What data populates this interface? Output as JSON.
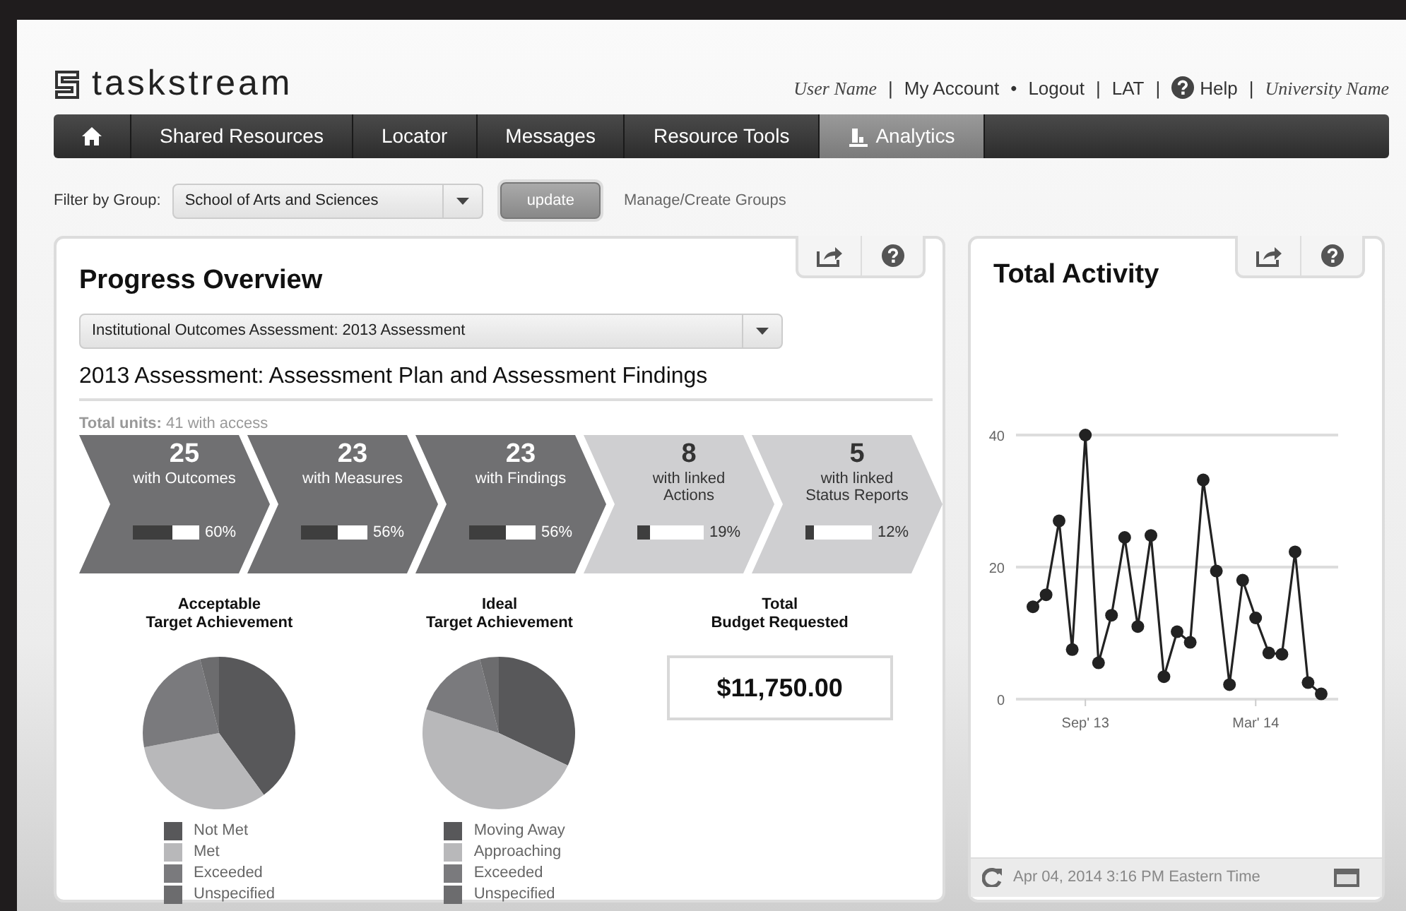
{
  "header": {
    "logo": "taskstream",
    "links": [
      {
        "kind": "name",
        "text": "User Name"
      },
      {
        "kind": "sep",
        "text": "|"
      },
      {
        "kind": "link",
        "text": "My Account"
      },
      {
        "kind": "sep",
        "text": "•"
      },
      {
        "kind": "link",
        "text": "Logout"
      },
      {
        "kind": "sep",
        "text": "|"
      },
      {
        "kind": "link",
        "text": "LAT"
      },
      {
        "kind": "sep",
        "text": "|"
      },
      {
        "kind": "help",
        "text": "Help"
      },
      {
        "kind": "sep",
        "text": "|"
      },
      {
        "kind": "name",
        "text": "University Name"
      }
    ]
  },
  "nav": {
    "items": [
      {
        "label": "Shared Resources",
        "selected": false,
        "icon": false
      },
      {
        "label": "Locator",
        "selected": false,
        "icon": false
      },
      {
        "label": "Messages",
        "selected": false,
        "icon": false
      },
      {
        "label": "Resource Tools",
        "selected": false,
        "icon": false
      },
      {
        "label": "Analytics",
        "selected": true,
        "icon": true
      }
    ]
  },
  "filter": {
    "label": "Filter by Group:",
    "value": "School of Arts and Sciences",
    "button": "update",
    "link": "Manage/Create Groups"
  },
  "progress": {
    "title": "Progress Overview",
    "select": "Institutional Outcomes Assessment: 2013 Assessment",
    "subtitle": "2013 Assessment: Assessment Plan and Assessment Findings",
    "units": "**Total units:** 41 with access",
    "steps": [
      {
        "count": "25",
        "label": "with Outcomes",
        "level": 0.6,
        "reading": "60%",
        "color": "#707072"
      },
      {
        "count": "23",
        "label": "with Measures",
        "level": 0.56,
        "reading": "56%",
        "color": "#707072"
      },
      {
        "count": "23",
        "label": "with Findings",
        "level": 0.56,
        "reading": "56%",
        "color": "#707072"
      },
      {
        "count": "8",
        "label": "with linked Actions",
        "level": 0.19,
        "reading": "19%",
        "color": "#cfcfd1"
      },
      {
        "count": "5",
        "label": "with linked Status Reports",
        "level": 0.12,
        "reading": "12%",
        "color": "#cfcfd1"
      }
    ],
    "pies": [
      {
        "title": [
          "Acceptable",
          "Target Achievement"
        ],
        "legend": [
          {
            "label": "Not Met",
            "color": "#58585a"
          },
          {
            "label": "Met",
            "color": "#b8b8ba"
          },
          {
            "label": "Exceeded",
            "color": "#7a7a7d"
          },
          {
            "label": "Unspecified",
            "color": "#6c6c6e"
          }
        ]
      },
      {
        "title": [
          "Ideal",
          "Target Achievement"
        ],
        "legend": [
          {
            "label": "Moving Away",
            "color": "#58585a"
          },
          {
            "label": "Approaching",
            "color": "#b8b8ba"
          },
          {
            "label": "Exceeded",
            "color": "#7a7a7d"
          },
          {
            "label": "Unspecified",
            "color": "#6c6c6e"
          }
        ]
      }
    ],
    "budget": {
      "title": [
        "Total",
        "Budget Requested"
      ],
      "amount": "$11,750.00"
    }
  },
  "activity": {
    "title": "Total Activity",
    "updated": "Apr 04, 2014 3:16 PM Eastern Time",
    "chart_data": {
      "type": "line",
      "categories": [
        null,
        null,
        null,
        null,
        "Sep' 13",
        null,
        null,
        null,
        null,
        null,
        null,
        null,
        null,
        null,
        null,
        null,
        null,
        "Mar' 14",
        null,
        null,
        null,
        null,
        null
      ],
      "values": [
        14,
        15.8,
        27,
        7.5,
        40,
        5.5,
        12.7,
        24.5,
        11,
        24.8,
        3.4,
        10.2,
        8.6,
        33.2,
        19.4,
        2.2,
        18,
        12.3,
        7,
        6.8,
        22.3,
        2.5,
        0.8
      ],
      "yticks": [
        0,
        20,
        40
      ],
      "ylim": [
        0,
        40
      ],
      "marker": "circle"
    }
  }
}
